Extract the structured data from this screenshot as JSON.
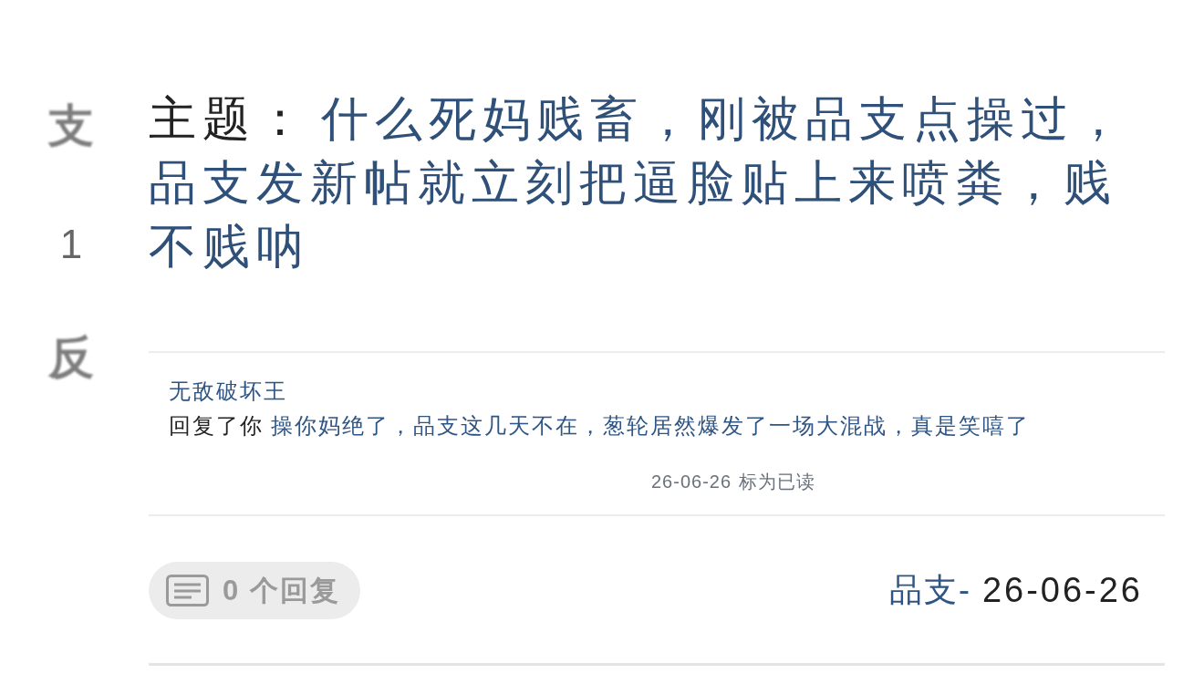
{
  "vote": {
    "up": "支",
    "score": "1",
    "down": "反"
  },
  "topic": {
    "label": "主题：",
    "title": "什么死妈贱畜，刚被品支点操过，品支发新帖就立刻把逼脸贴上来喷粪，贱不贱呐"
  },
  "replies": [
    {
      "author": "无敌破坏王",
      "action": "回复了你",
      "excerpt": "操你妈绝了，品支这几天不在，葱轮居然爆发了一场大混战，真是笑嘻了",
      "date": "26-06-26",
      "mark_read": "标为已读"
    }
  ],
  "footer": {
    "reply_count": "0 个回复",
    "author": "品支-",
    "date": "26-06-26"
  }
}
